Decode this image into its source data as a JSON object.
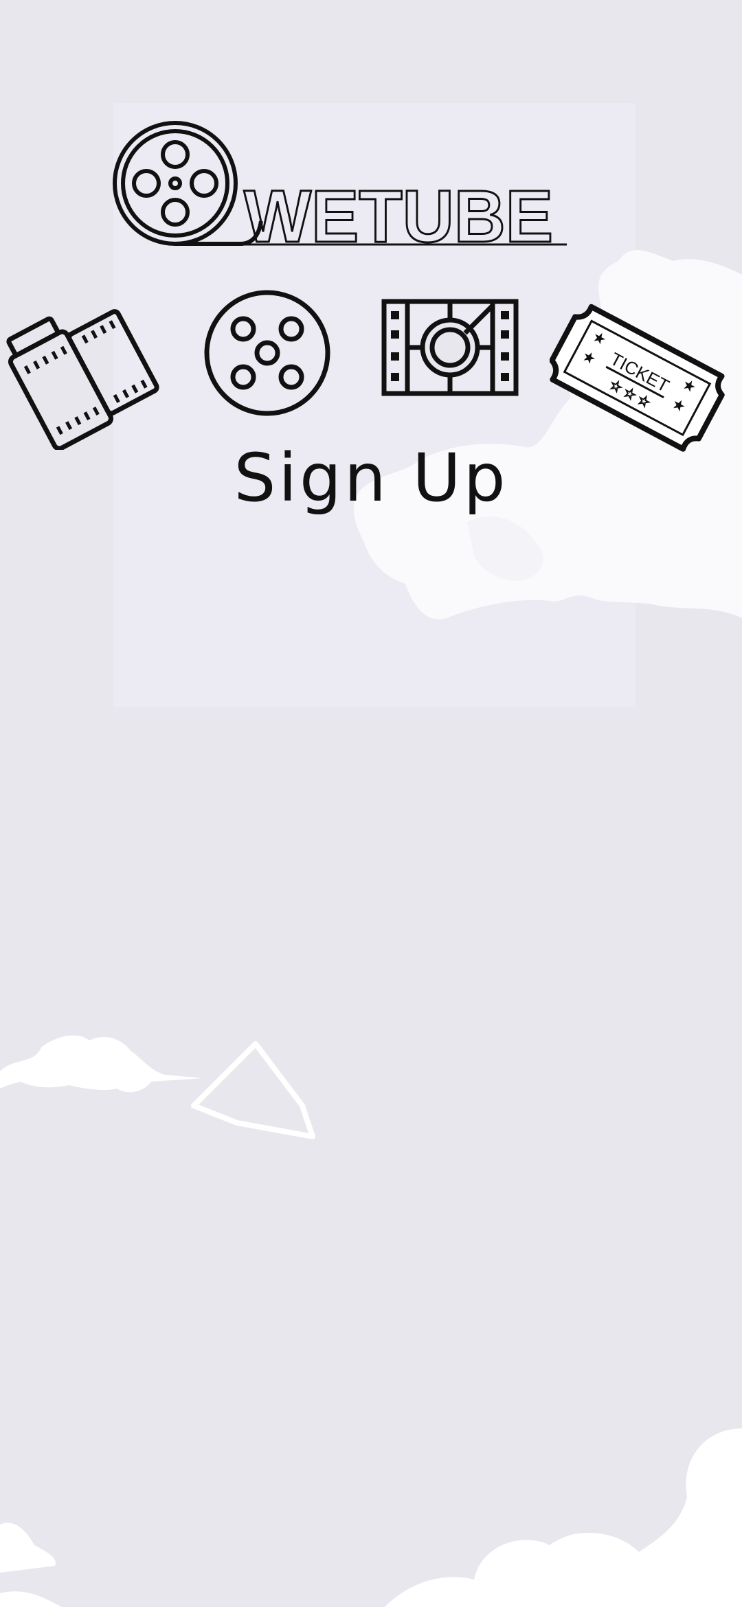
{
  "app": {
    "logo_text": "WETUBE",
    "title": "Sign Up"
  },
  "icons": [
    {
      "name": "film-canister-icon"
    },
    {
      "name": "film-reel-icon"
    },
    {
      "name": "film-strip-icon"
    },
    {
      "name": "ticket-icon",
      "label": "TICKET"
    }
  ],
  "colors": {
    "background": "#e8e7ee",
    "ink": "#111111",
    "cloud": "#ffffff"
  }
}
